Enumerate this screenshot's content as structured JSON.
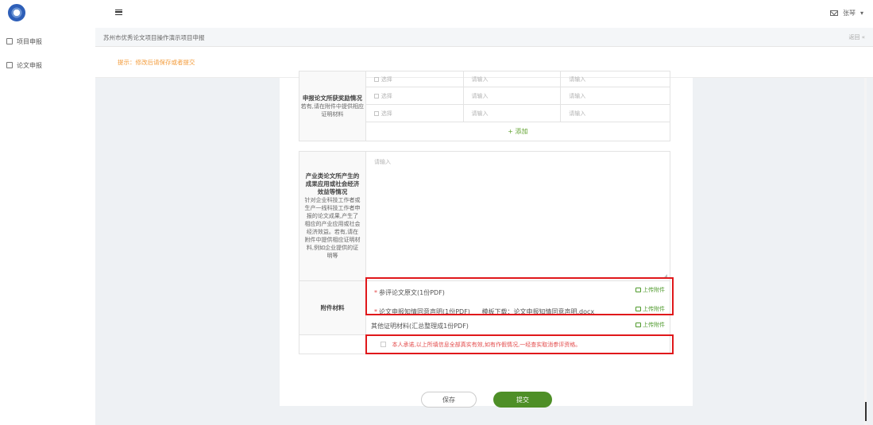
{
  "sidebar": {
    "items": [
      {
        "label": "项目申报",
        "icon": "calendar-icon"
      },
      {
        "label": "论文申报",
        "icon": "edit-icon"
      }
    ]
  },
  "topbar": {
    "user_name": "张琴"
  },
  "breadcrumb": "苏州市优秀论文项目操作演示项目申报",
  "back_label": "返回",
  "tip": "提示：修改后请保存或者提交",
  "awards": {
    "label_main": "申报论文所获奖励情况",
    "label_sub": "若有,请在附件中提供相应证明材料",
    "rows": [
      {
        "select": "选择",
        "input1": "请输入",
        "input2": "请输入"
      },
      {
        "select": "选择",
        "input1": "请输入",
        "input2": "请输入"
      },
      {
        "select": "选择",
        "input1": "请输入",
        "input2": "请输入"
      }
    ],
    "add_label": "+ 添加"
  },
  "benefit": {
    "label_main": "产业类论文所产生的成果应用或社会经济效益等情况",
    "label_sub": "针对企业科技工作者或生产一线科技工作者申报的论文成果,产生了相应的产业应用或社会经济效益。若有,请在附件中提供相应证明材料,例如企业提供的证明等",
    "placeholder": "请输入"
  },
  "attachments": {
    "label": "附件材料",
    "items": [
      {
        "required": true,
        "name": "参评论文原文(1份PDF)",
        "template": "",
        "upload": "上传附件"
      },
      {
        "required": true,
        "name": "论文申报知情同意声明(1份PDF)",
        "template": "模板下载：论文申报知情同意声明.docx",
        "upload": "上传附件"
      },
      {
        "required": false,
        "name": "其他证明材料(汇总整理成1份PDF)",
        "template": "",
        "upload": "上传附件"
      }
    ]
  },
  "promise": "本人承诺,以上所填信息全部真实有效,如有作假情况,一经查实取消参评资格。",
  "buttons": {
    "save": "保存",
    "submit": "提交"
  },
  "colors": {
    "primary": "#4e8f27",
    "warning": "#f39c3c",
    "danger": "#e34b4b",
    "highlight": "#e0181b"
  }
}
